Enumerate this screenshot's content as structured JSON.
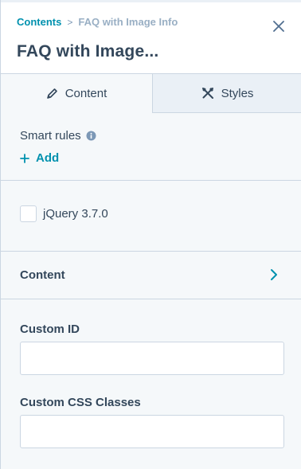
{
  "breadcrumb": {
    "root": "Contents",
    "separator": ">",
    "current": "FAQ with Image Info"
  },
  "title": "FAQ with Image...",
  "tabs": [
    {
      "label": "Content",
      "icon": "pencil-icon",
      "active": true
    },
    {
      "label": "Styles",
      "icon": "paint-tools-icon",
      "active": false
    }
  ],
  "smart_rules": {
    "label": "Smart rules",
    "add_label": "Add"
  },
  "checkbox": {
    "label": "jQuery 3.7.0",
    "checked": false
  },
  "accordion": {
    "label": "Content"
  },
  "fields": {
    "custom_id": {
      "label": "Custom ID",
      "value": ""
    },
    "custom_css": {
      "label": "Custom CSS Classes",
      "value": ""
    }
  },
  "colors": {
    "accent": "#0091ae",
    "text": "#33475b",
    "border": "#cbd6e2",
    "panel_bg": "#f5f8fa"
  }
}
